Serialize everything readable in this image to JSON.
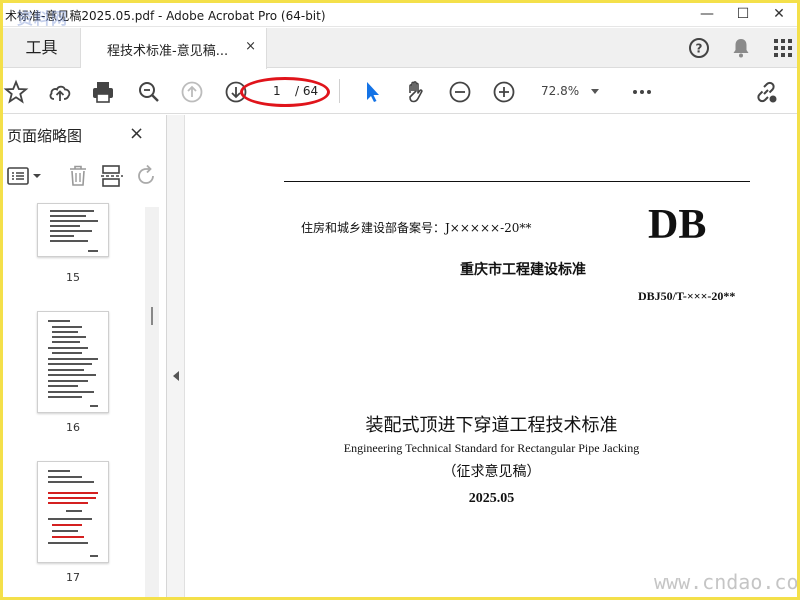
{
  "window": {
    "title": "术标准-意见稿2025.05.pdf - Adobe Acrobat Pro (64-bit)",
    "watermark": "资料网",
    "controls": [
      "minimize-icon",
      "maximize-icon",
      "close-icon"
    ]
  },
  "tabs": {
    "tools_label": "工具",
    "doc_label": "程技术标准-意见稿...",
    "doc_close": "×",
    "right_icons": [
      "help-icon",
      "bell-icon",
      "apps-grid-icon"
    ]
  },
  "toolbar": {
    "icons": [
      "star-icon",
      "cloud-upload-icon",
      "print-icon",
      "zoom-search-icon",
      "page-up-icon",
      "page-down-icon",
      "select-arrow-icon",
      "hand-icon",
      "zoom-out-icon",
      "zoom-in-icon",
      "more-icon",
      "share-link-icon"
    ],
    "current_page": "1",
    "total_pages": "/ 64",
    "zoom": "72.8%",
    "highlight_color": "#e0141b"
  },
  "sidebar": {
    "title": "页面缩略图",
    "close": "×",
    "tool_icons": [
      "thumbnail-options-icon",
      "delete-icon",
      "extract-icon",
      "rotate-icon"
    ],
    "pages": [
      "15",
      "16",
      "17"
    ]
  },
  "document": {
    "registration": "住房和城乡建设部备案号：J×××××-20**",
    "db_mark": "DB",
    "standard_org": "重庆市工程建设标准",
    "standard_code": "DBJ50/T-×××-20**",
    "title_cn": "装配式顶进下穿道工程技术标准",
    "title_en": "Engineering Technical Standard for Rectangular Pipe Jacking",
    "draft": "（征求意见稿）",
    "date": "2025.05"
  },
  "footer_watermark": "www.cndao.com",
  "colors": {
    "frame": "#f4e04a",
    "accent_blue": "#1473e6"
  }
}
